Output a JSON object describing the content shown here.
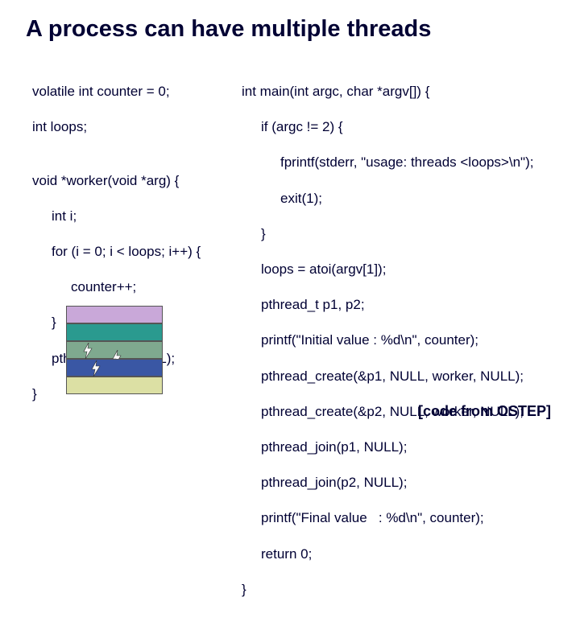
{
  "title": "A process can have multiple threads",
  "left_code": {
    "l1": "volatile int counter = 0;",
    "l2": "int loops;",
    "l3": "",
    "l4": "void *worker(void *arg) {",
    "l5": "int i;",
    "l6": "for (i = 0; i < loops; i++) {",
    "l7": "counter++;",
    "l8": "}",
    "l9": "pthread_exit(NULL);",
    "l10": "}"
  },
  "right_code": {
    "r1": "int main(int argc, char *argv[]) {",
    "r2": "if (argc != 2) {",
    "r3": "fprintf(stderr, \"usage: threads <loops>\\n\");",
    "r4": "exit(1);",
    "r5": "}",
    "r6": "loops = atoi(argv[1]);",
    "r7": "pthread_t p1, p2;",
    "r8": "printf(\"Initial value : %d\\n\", counter);",
    "r9": "pthread_create(&p1, NULL, worker, NULL);",
    "r10": "pthread_create(&p2, NULL, worker, NULL);",
    "r11": "pthread_join(p1, NULL);",
    "r12": "pthread_join(p2, NULL);",
    "r13": "printf(\"Final value   : %d\\n\", counter);",
    "r14": "return 0;",
    "r15": "}"
  },
  "attribution": "[code from OSTEP]",
  "diagram": {
    "layers": [
      "segment-top",
      "segment-teal",
      "segment-mid",
      "segment-blue",
      "segment-tan"
    ],
    "bolt_icon": "lightning-bolt"
  }
}
